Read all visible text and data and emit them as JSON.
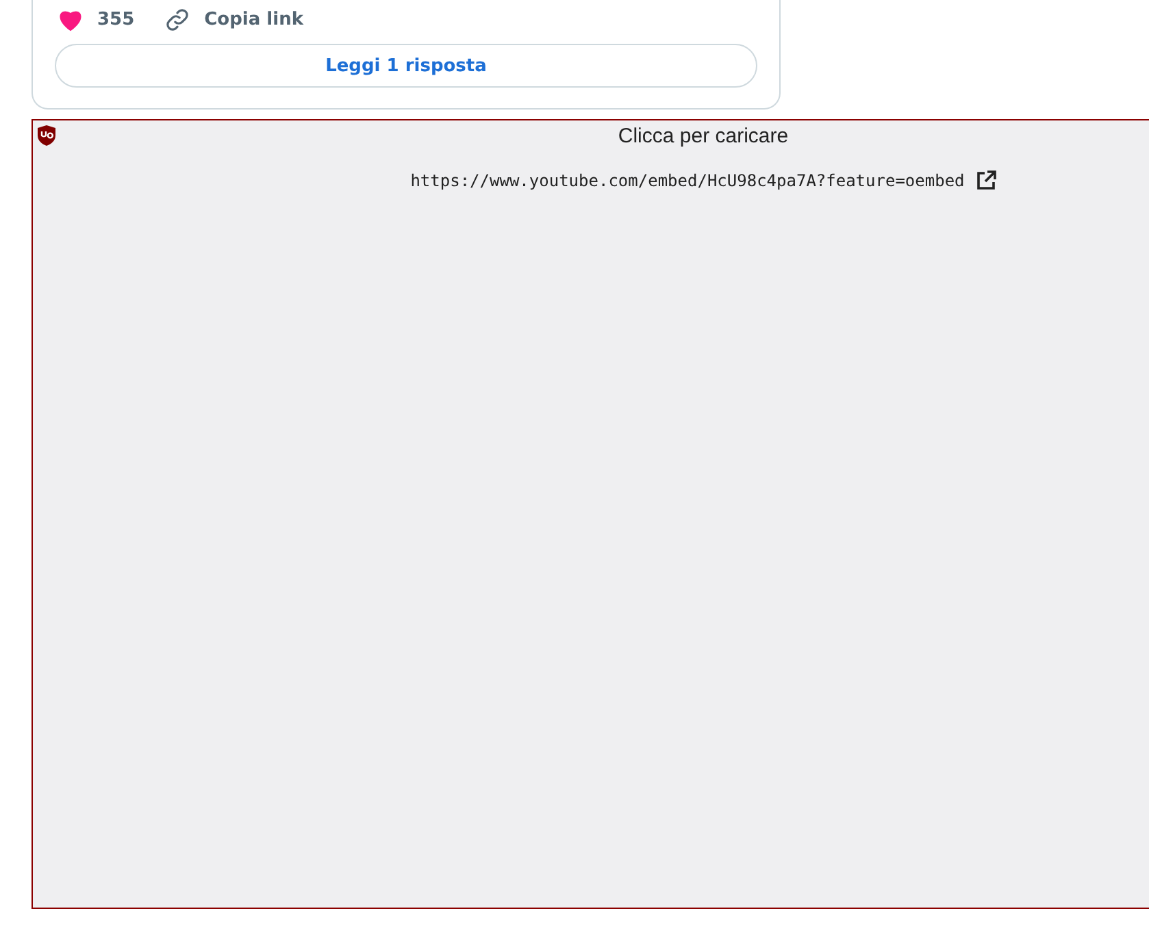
{
  "post_card": {
    "likes": "355",
    "copy_link": "Copia link",
    "read_replies": "Leggi 1 risposta"
  },
  "blocked_embed": {
    "title": "Clicca per caricare",
    "url": "https://www.youtube.com/embed/HcU98c4pa7A?feature=oembed"
  }
}
